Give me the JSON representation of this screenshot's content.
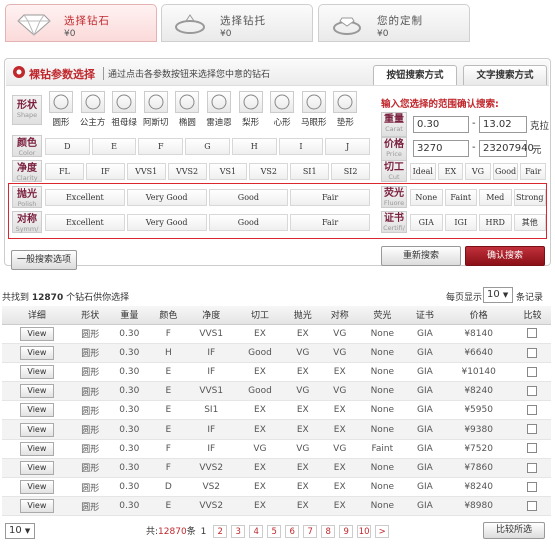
{
  "steps": [
    {
      "title": "选择钻石",
      "price": "¥0",
      "icon": "diamond-icon"
    },
    {
      "title": "选择钻托",
      "price": "¥0",
      "icon": "ring-setting-icon"
    },
    {
      "title": "您的定制",
      "price": "¥0",
      "icon": "ring-icon"
    }
  ],
  "panel": {
    "title": "裸钻参数选择",
    "hint": "通过点击各参数按钮来选择您中意的钻石",
    "tab_button": "按钮搜索方式",
    "tab_text": "文字搜索方式",
    "range_title": "输入您选择的范围确认搜索:"
  },
  "labels": {
    "shape": {
      "cn": "形状",
      "en": "Shape"
    },
    "color": {
      "cn": "颜色",
      "en": "Color"
    },
    "clarity": {
      "cn": "净度",
      "en": "Clarity"
    },
    "polish": {
      "cn": "抛光",
      "en": "Polish"
    },
    "symm": {
      "cn": "对称",
      "en": "Symm/"
    },
    "carat": {
      "cn": "重量",
      "en": "Carat"
    },
    "price": {
      "cn": "价格",
      "en": "Price"
    },
    "cut": {
      "cn": "切工",
      "en": "Cut"
    },
    "fluore": {
      "cn": "荧光",
      "en": "Fluore"
    },
    "cert": {
      "cn": "证书",
      "en": "Certifi/"
    }
  },
  "shapes": [
    "圆形",
    "公主方",
    "祖母绿",
    "阿斯切",
    "椭圆",
    "雷迪恩",
    "梨形",
    "心形",
    "马眼形",
    "垫形"
  ],
  "colors": [
    "D",
    "E",
    "F",
    "G",
    "H",
    "I",
    "J"
  ],
  "clarities": [
    "FL",
    "IF",
    "VVS1",
    "VVS2",
    "VS1",
    "VS2",
    "SI1",
    "SI2"
  ],
  "polish": [
    "Excellent",
    "Very Good",
    "Good",
    "Fair"
  ],
  "symmetry": [
    "Excellent",
    "Very Good",
    "Good",
    "Fair"
  ],
  "cuts": [
    "Ideal",
    "EX",
    "VG",
    "Good",
    "Fair"
  ],
  "fluorescence": [
    "None",
    "Faint",
    "Med",
    "Strong"
  ],
  "certs": [
    "GIA",
    "IGI",
    "HRD",
    "其他"
  ],
  "range": {
    "carat_min": "0.30",
    "carat_max": "13.02",
    "carat_unit": "克拉",
    "price_min": "3270",
    "price_max": "23207940",
    "price_unit": "元",
    "dash": "-"
  },
  "buttons": {
    "general": "一般搜索选项",
    "reset": "重新搜索",
    "confirm": "确认搜索",
    "compare": "比较所选"
  },
  "results": {
    "found_prefix": "共找到",
    "count": "12870",
    "found_suffix": "个钻石供你选择",
    "per_page_label": "每页显示",
    "per_page_value": "10",
    "per_page_suffix": "条记录"
  },
  "table": {
    "headers": [
      "详细",
      "形状",
      "重量",
      "颜色",
      "净度",
      "切工",
      "抛光",
      "对称",
      "荧光",
      "证书",
      "价格",
      "比较"
    ],
    "view_label": "View",
    "rows": [
      [
        "圆形",
        "0.30",
        "F",
        "VVS1",
        "EX",
        "EX",
        "VG",
        "None",
        "GIA",
        "¥8140"
      ],
      [
        "圆形",
        "0.30",
        "H",
        "IF",
        "Good",
        "VG",
        "VG",
        "None",
        "GIA",
        "¥6640"
      ],
      [
        "圆形",
        "0.30",
        "E",
        "IF",
        "EX",
        "EX",
        "EX",
        "None",
        "GIA",
        "¥10140"
      ],
      [
        "圆形",
        "0.30",
        "E",
        "VVS1",
        "Good",
        "VG",
        "VG",
        "None",
        "GIA",
        "¥8240"
      ],
      [
        "圆形",
        "0.30",
        "E",
        "SI1",
        "EX",
        "EX",
        "EX",
        "None",
        "GIA",
        "¥5950"
      ],
      [
        "圆形",
        "0.30",
        "E",
        "IF",
        "EX",
        "EX",
        "EX",
        "None",
        "GIA",
        "¥9380"
      ],
      [
        "圆形",
        "0.30",
        "F",
        "IF",
        "VG",
        "VG",
        "VG",
        "Faint",
        "GIA",
        "¥7520"
      ],
      [
        "圆形",
        "0.30",
        "F",
        "VVS2",
        "EX",
        "EX",
        "EX",
        "None",
        "GIA",
        "¥7860"
      ],
      [
        "圆形",
        "0.30",
        "D",
        "VS2",
        "EX",
        "EX",
        "EX",
        "None",
        "GIA",
        "¥8240"
      ],
      [
        "圆形",
        "0.30",
        "E",
        "VVS2",
        "EX",
        "EX",
        "EX",
        "None",
        "GIA",
        "¥8980"
      ]
    ]
  },
  "pager": {
    "select_value": "10",
    "total_prefix": "共:",
    "total": "12870",
    "unit": "条",
    "current": "1",
    "pages": [
      "2",
      "3",
      "4",
      "5",
      "6",
      "7",
      "8",
      "9",
      "10"
    ],
    "next": ">"
  },
  "colors_theme": {
    "accent": "#c0282d",
    "highlight_border": "#d9262f"
  }
}
